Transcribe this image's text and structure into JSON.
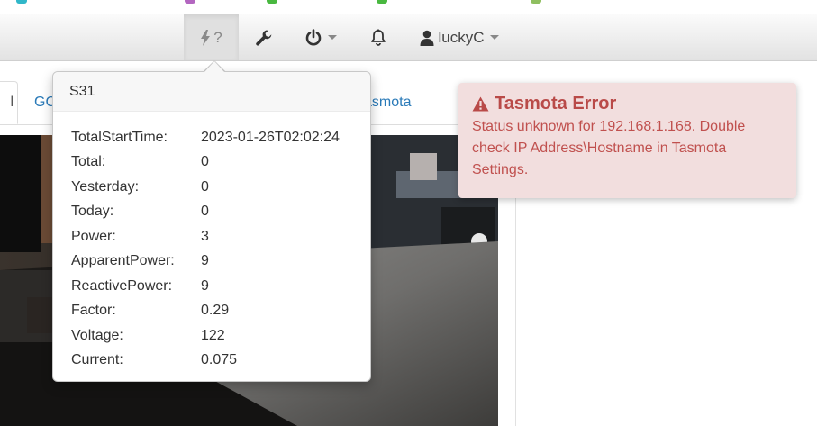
{
  "navbar": {
    "help_glyph": "?",
    "user_name": "luckyC"
  },
  "tabs": [
    {
      "label": "l"
    },
    {
      "label": "GC"
    },
    {
      "label": "asmota"
    }
  ],
  "popover": {
    "title": "S31",
    "rows": [
      {
        "key": "TotalStartTime:",
        "value": "2023-01-26T02:02:24"
      },
      {
        "key": "Total:",
        "value": "0"
      },
      {
        "key": "Yesterday:",
        "value": "0"
      },
      {
        "key": "Today:",
        "value": "0"
      },
      {
        "key": "Power:",
        "value": "3"
      },
      {
        "key": "ApparentPower:",
        "value": "9"
      },
      {
        "key": "ReactivePower:",
        "value": "9"
      },
      {
        "key": "Factor:",
        "value": "0.29"
      },
      {
        "key": "Voltage:",
        "value": "122"
      },
      {
        "key": "Current:",
        "value": "0.075"
      }
    ]
  },
  "toast": {
    "title": "Tasmota Error",
    "message": "Status unknown for 192.168.1.168. Double check IP Address\\Hostname in Tasmota Settings."
  },
  "colors": {
    "toast_bg": "#f2dede",
    "toast_text": "#b94a48",
    "link": "#2a7ab8"
  }
}
